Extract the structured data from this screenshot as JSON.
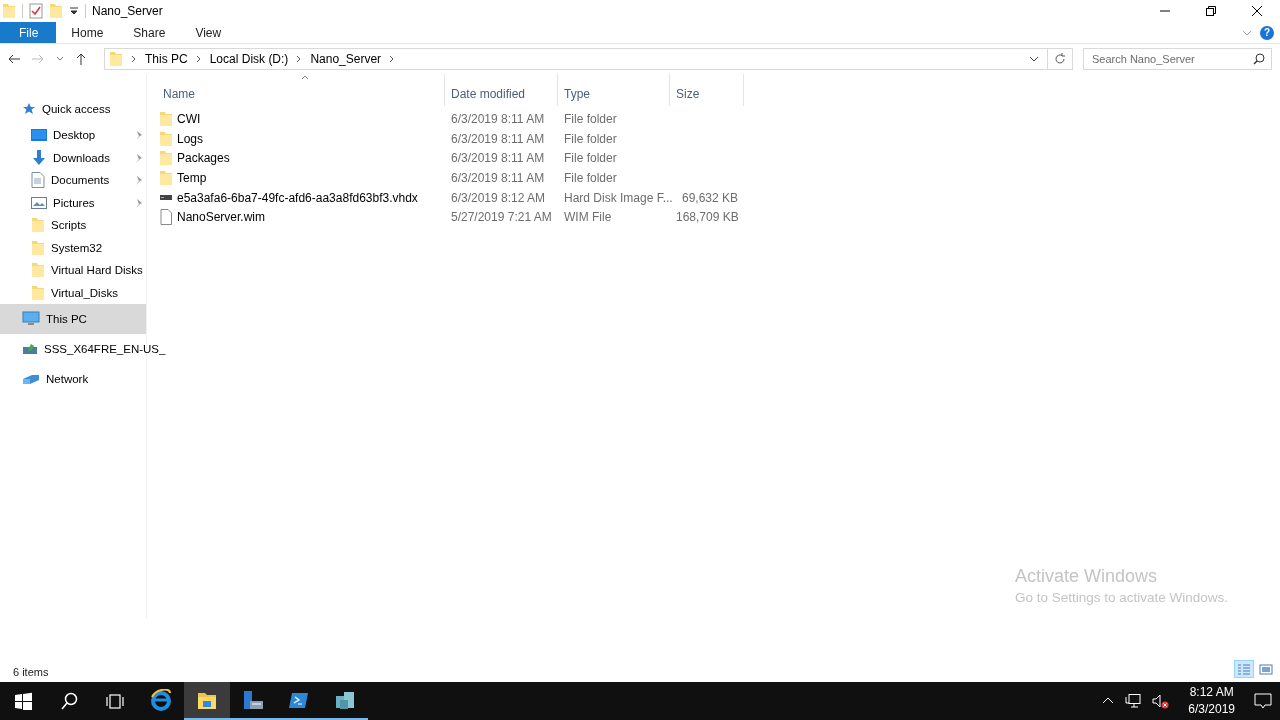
{
  "window": {
    "title": "Nano_Server"
  },
  "ribbon": {
    "tabs": [
      {
        "label": "File",
        "kind": "file"
      },
      {
        "label": "Home",
        "kind": "tab"
      },
      {
        "label": "Share",
        "kind": "tab"
      },
      {
        "label": "View",
        "kind": "tab"
      }
    ],
    "help": "?"
  },
  "address_bar": {
    "path": [
      "This PC",
      "Local Disk (D:)",
      "Nano_Server"
    ]
  },
  "search": {
    "placeholder": "Search Nano_Server"
  },
  "sidebar": {
    "items": [
      {
        "label": "Quick access",
        "kind": "star",
        "selected": false,
        "children": [
          {
            "label": "Desktop",
            "kind": "desktop",
            "pinned": true,
            "selected": false
          },
          {
            "label": "Downloads",
            "kind": "download",
            "pinned": true,
            "selected": false
          },
          {
            "label": "Documents",
            "kind": "document",
            "pinned": true,
            "selected": false
          },
          {
            "label": "Pictures",
            "kind": "picture",
            "pinned": true,
            "selected": false
          },
          {
            "label": "Scripts",
            "kind": "folder",
            "pinned": false,
            "selected": false
          },
          {
            "label": "System32",
            "kind": "folder",
            "pinned": false,
            "selected": false
          },
          {
            "label": "Virtual Hard Disks",
            "kind": "folder",
            "pinned": false,
            "selected": false
          },
          {
            "label": "Virtual_Disks",
            "kind": "folder",
            "pinned": false,
            "selected": false
          }
        ]
      },
      {
        "label": "This PC",
        "kind": "pc",
        "selected": true
      },
      {
        "label": "SSS_X64FRE_EN-US_",
        "kind": "disc",
        "selected": false
      },
      {
        "label": "Network",
        "kind": "network",
        "selected": false
      }
    ]
  },
  "table": {
    "columns": [
      {
        "label": "Name",
        "sorted": true
      },
      {
        "label": "Date modified",
        "sorted": false
      },
      {
        "label": "Type",
        "sorted": false
      },
      {
        "label": "Size",
        "sorted": false
      }
    ],
    "rows": [
      {
        "name": "CWI",
        "date": "6/3/2019 8:11 AM",
        "type": "File folder",
        "kind": "folder"
      },
      {
        "name": "Logs",
        "date": "6/3/2019 8:11 AM",
        "type": "File folder",
        "kind": "folder"
      },
      {
        "name": "Packages",
        "date": "6/3/2019 8:11 AM",
        "type": "File folder",
        "kind": "folder"
      },
      {
        "name": "Temp",
        "date": "6/3/2019 8:11 AM",
        "type": "File folder",
        "kind": "folder"
      },
      {
        "name": "e5a3afa6-6ba7-49fc-afd6-aa3a8fd63bf3.vhdx",
        "date": "6/3/2019 8:12 AM",
        "type": "Hard Disk Image F...",
        "size": "69,632 KB",
        "kind": "disk"
      },
      {
        "name": "NanoServer.wim",
        "date": "5/27/2019 7:21 AM",
        "type": "WIM File",
        "size": "168,709 KB",
        "kind": "file"
      }
    ]
  },
  "status_bar": {
    "count": "6 items",
    "views": [
      {
        "kind": "details",
        "selected": true
      },
      {
        "kind": "large",
        "selected": false
      }
    ]
  },
  "activation": {
    "title": "Activate Windows",
    "message": "Go to Settings to activate Windows."
  },
  "taskbar": {
    "apps": [
      {
        "kind": "browser",
        "running": false,
        "active": false
      },
      {
        "kind": "explorer",
        "running": true,
        "active": true
      },
      {
        "kind": "server",
        "running": true,
        "active": false
      },
      {
        "kind": "shell",
        "running": true,
        "active": false
      },
      {
        "kind": "blocks",
        "running": true,
        "active": false
      }
    ],
    "time": "8:12 AM",
    "date": "6/3/2019"
  }
}
